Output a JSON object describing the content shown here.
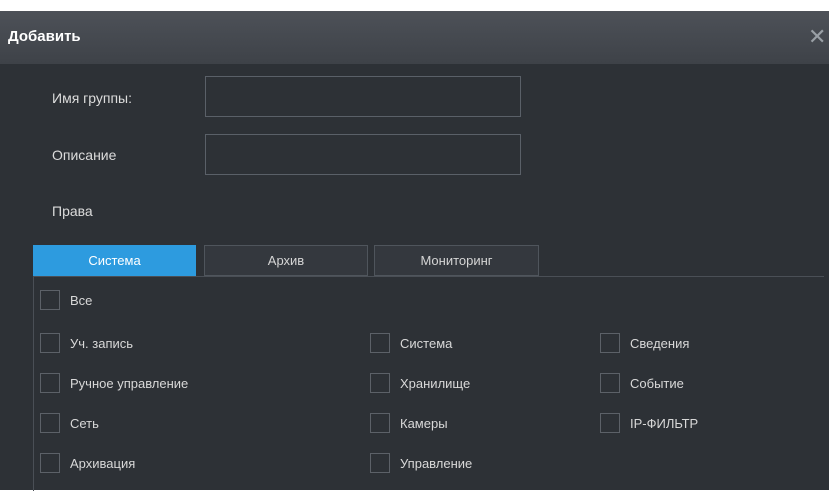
{
  "dialog": {
    "title": "Добавить",
    "close_glyph": "✕"
  },
  "form": {
    "group_name_label": "Имя группы:",
    "group_name_value": "",
    "description_label": "Описание",
    "description_value": "",
    "rights_label": "Права"
  },
  "tabs": [
    {
      "label": "Система",
      "active": true
    },
    {
      "label": "Архив",
      "active": false
    },
    {
      "label": "Мониторинг",
      "active": false
    }
  ],
  "permissions": {
    "all": "Все",
    "col1": [
      "Уч. запись",
      "Ручное управление",
      "Сеть",
      "Архивация"
    ],
    "col2": [
      "Система",
      "Хранилище",
      "Камеры",
      "Управление"
    ],
    "col3": [
      "Сведения",
      "Событие",
      "IP-ФИЛЬТР"
    ]
  },
  "colors": {
    "accent": "#2d9bdf",
    "background": "#2d3136",
    "titlebar": "#45494f"
  }
}
